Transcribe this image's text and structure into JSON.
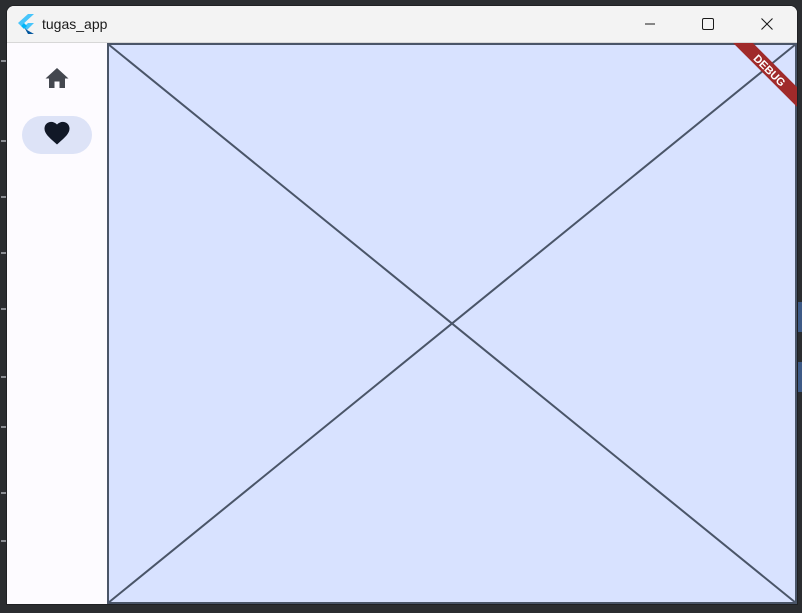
{
  "window": {
    "title": "tugas_app",
    "controls": {
      "minimize_icon": "minimize-icon",
      "maximize_icon": "maximize-icon",
      "close_icon": "close-icon"
    }
  },
  "nav_rail": {
    "items": [
      {
        "icon": "home-icon",
        "selected": false
      },
      {
        "icon": "heart-icon",
        "selected": true
      }
    ]
  },
  "main": {
    "placeholder": "image-placeholder",
    "debug_banner": "DEBUG"
  },
  "colors": {
    "content_bg": "#fdfbff",
    "rail_indicator": "#dde3f7",
    "placeholder_fill": "#d8e2ff",
    "placeholder_stroke": "#4a5568",
    "debug_ribbon": "#a02a2a",
    "flutter_blue": "#47c5fb"
  }
}
